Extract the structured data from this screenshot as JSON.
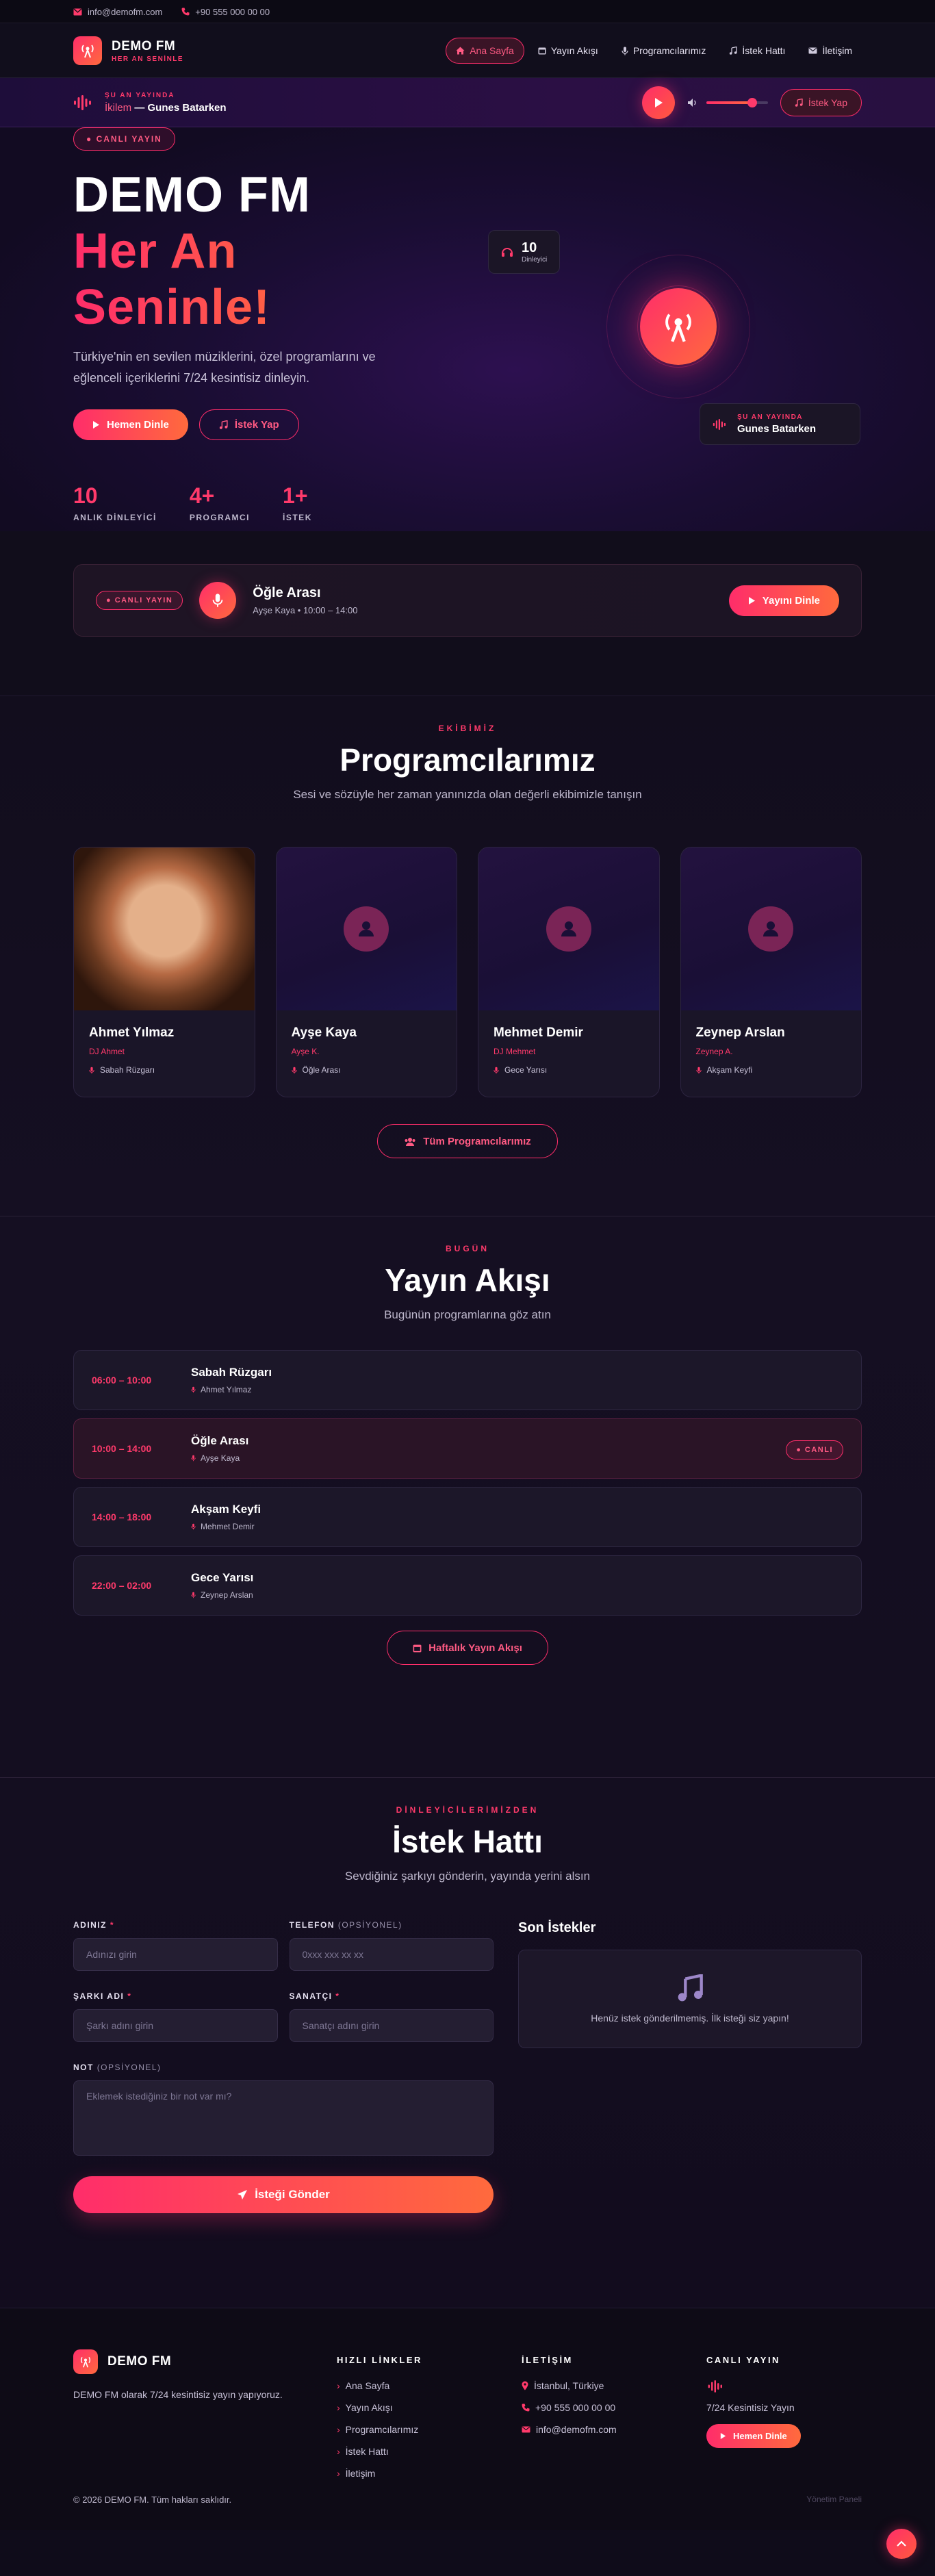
{
  "topbar": {
    "email": "info@demofm.com",
    "phone": "+90 555 000 00 00"
  },
  "brand": {
    "name": "DEMO FM",
    "tagline": "HER AN SENİNLE"
  },
  "nav": [
    {
      "label": "Ana Sayfa",
      "icon": "home-icon"
    },
    {
      "label": "Yayın Akışı",
      "icon": "calendar-icon"
    },
    {
      "label": "Programcılarımız",
      "icon": "mic-icon"
    },
    {
      "label": "İstek Hattı",
      "icon": "music-icon"
    },
    {
      "label": "İletişim",
      "icon": "envelope-icon"
    }
  ],
  "player": {
    "label": "ŞU AN YAYINDA",
    "artist": "İkilem",
    "separator": " — ",
    "title": "Gunes Batarken",
    "volume": 0.75,
    "request_label": "İstek Yap"
  },
  "hero": {
    "live_pill": "● CANLI YAYIN",
    "title_line1": "DEMO FM",
    "title_line2": "Her An",
    "title_line3": "Seninle!",
    "description": "Türkiye'nin en sevilen müziklerini, özel programlarını ve eğlenceli içeriklerini 7/24 kesintisiz dinleyin.",
    "listen_btn": "Hemen Dinle",
    "request_btn": "İstek Yap",
    "stats": [
      {
        "num": "10",
        "label": "ANLIK DİNLEYİCİ"
      },
      {
        "num": "4+",
        "label": "PROGRAMCI"
      },
      {
        "num": "1+",
        "label": "İSTEK"
      }
    ],
    "listeners_card": {
      "num": "10",
      "label": "Dinleyici"
    },
    "onair_card": {
      "label": "ŞU AN YAYINDA",
      "title": "Gunes Batarken"
    }
  },
  "now": {
    "badge": "● CANLI YAYIN",
    "title": "Öğle Arası",
    "sub": "Ayşe Kaya • 10:00 – 14:00",
    "btn": "Yayını Dinle"
  },
  "programmers": {
    "eyebrow": "EKİBİMİZ",
    "title": "Programcılarımız",
    "subtitle": "Sesi ve sözüyle her zaman yanınızda olan değerli ekibimizle tanışın",
    "hosts": [
      {
        "name": "Ahmet Yılmaz",
        "nick": "DJ Ahmet",
        "show": "Sabah Rüzgarı"
      },
      {
        "name": "Ayşe Kaya",
        "nick": "Ayşe K.",
        "show": "Öğle Arası"
      },
      {
        "name": "Mehmet Demir",
        "nick": "DJ Mehmet",
        "show": "Gece Yarısı"
      },
      {
        "name": "Zeynep Arslan",
        "nick": "Zeynep A.",
        "show": "Akşam Keyfi"
      }
    ],
    "all_btn": "Tüm Programcılarımız"
  },
  "schedule": {
    "eyebrow": "BUGÜN",
    "title": "Yayın Akışı",
    "subtitle": "Bugünün programlarına göz atın",
    "items": [
      {
        "time": "06:00 – 10:00",
        "title": "Sabah Rüzgarı",
        "host": "Ahmet Yılmaz"
      },
      {
        "time": "10:00 – 14:00",
        "title": "Öğle Arası",
        "host": "Ayşe Kaya",
        "live": "● CANLI"
      },
      {
        "time": "14:00 – 18:00",
        "title": "Akşam Keyfi",
        "host": "Mehmet Demir"
      },
      {
        "time": "22:00 – 02:00",
        "title": "Gece Yarısı",
        "host": "Zeynep Arslan"
      }
    ],
    "week_btn": "Haftalık Yayın Akışı"
  },
  "request": {
    "eyebrow": "DİNLEYİCİLERİMİZDEN",
    "title": "İstek Hattı",
    "subtitle": "Sevdiğiniz şarkıyı gönderin, yayında yerini alsın",
    "name_label": "ADINIZ",
    "name_placeholder": "Adınızı girin",
    "phone_label": "TELEFON",
    "phone_opt": "(OPSİYONEL)",
    "phone_placeholder": "0xxx xxx xx xx",
    "song_label": "ŞARKI ADI",
    "song_placeholder": "Şarkı adını girin",
    "artist_label": "SANATÇI",
    "artist_placeholder": "Sanatçı adını girin",
    "note_label": "NOT",
    "note_opt": "(OPSİYONEL)",
    "note_placeholder": "Eklemek istediğiniz bir not var mı?",
    "required_mark": "*",
    "submit": "İsteği Gönder",
    "recent_title": "Son İstekler",
    "recent_empty": "Henüz istek gönderilmemiş. İlk isteği siz yapın!"
  },
  "footer": {
    "brand": "DEMO FM",
    "desc": "DEMO FM olarak 7/24 kesintisiz yayın yapıyoruz.",
    "quick_title": "HIZLI LİNKLER",
    "quick_links": [
      "Ana Sayfa",
      "Yayın Akışı",
      "Programcılarımız",
      "İstek Hattı",
      "İletişim"
    ],
    "contact_title": "İLETİŞİM",
    "contact": {
      "city": "İstanbul, Türkiye",
      "phone": "+90 555 000 00 00",
      "email": "info@demofm.com"
    },
    "live_title": "CANLI YAYIN",
    "live_text": "7/24 Kesintisiz Yayın",
    "live_btn": "Hemen Dinle",
    "copyright": "© 2026 DEMO FM. Tüm hakları saklıdır.",
    "admin": "Yönetim Paneli"
  },
  "colors": {
    "accent": "#ff2d6a",
    "accent2": "#ff6a3d",
    "bg": "#0f0c1a"
  }
}
